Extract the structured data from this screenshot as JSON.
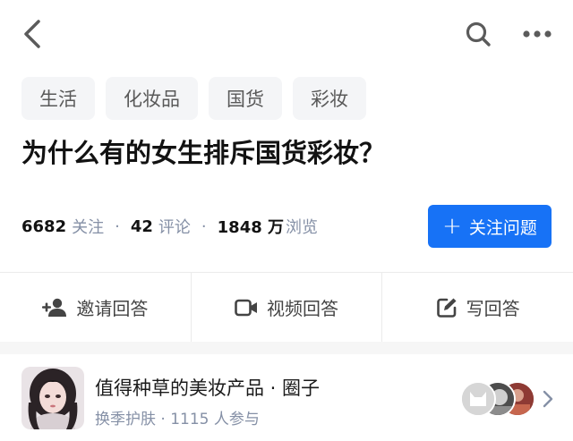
{
  "header": {
    "back_icon": "chevron-left-icon",
    "search_icon": "search-icon",
    "more_icon": "more-horizontal-icon"
  },
  "tags": [
    "生活",
    "化妆品",
    "国货",
    "彩妆"
  ],
  "question": {
    "title": "为什么有的女生排斥国货彩妆？"
  },
  "stats": {
    "followers_num": "6682",
    "followers_label": "关注",
    "comments_num": "42",
    "comments_label": "评论",
    "views_num": "1848 万",
    "views_label": "浏览",
    "separator": "·"
  },
  "follow_button": {
    "plus": "+",
    "label": "关注问题",
    "color": "#1772f6"
  },
  "actions": {
    "invite": {
      "label": "邀请回答",
      "icon": "invite-user-icon"
    },
    "video": {
      "label": "视频回答",
      "icon": "video-camera-icon"
    },
    "write": {
      "label": "写回答",
      "icon": "edit-icon"
    }
  },
  "circle": {
    "title": "值得种草的美妆产品 · 圈子",
    "subtitle": "换季护肤 · 1115 人参与"
  }
}
